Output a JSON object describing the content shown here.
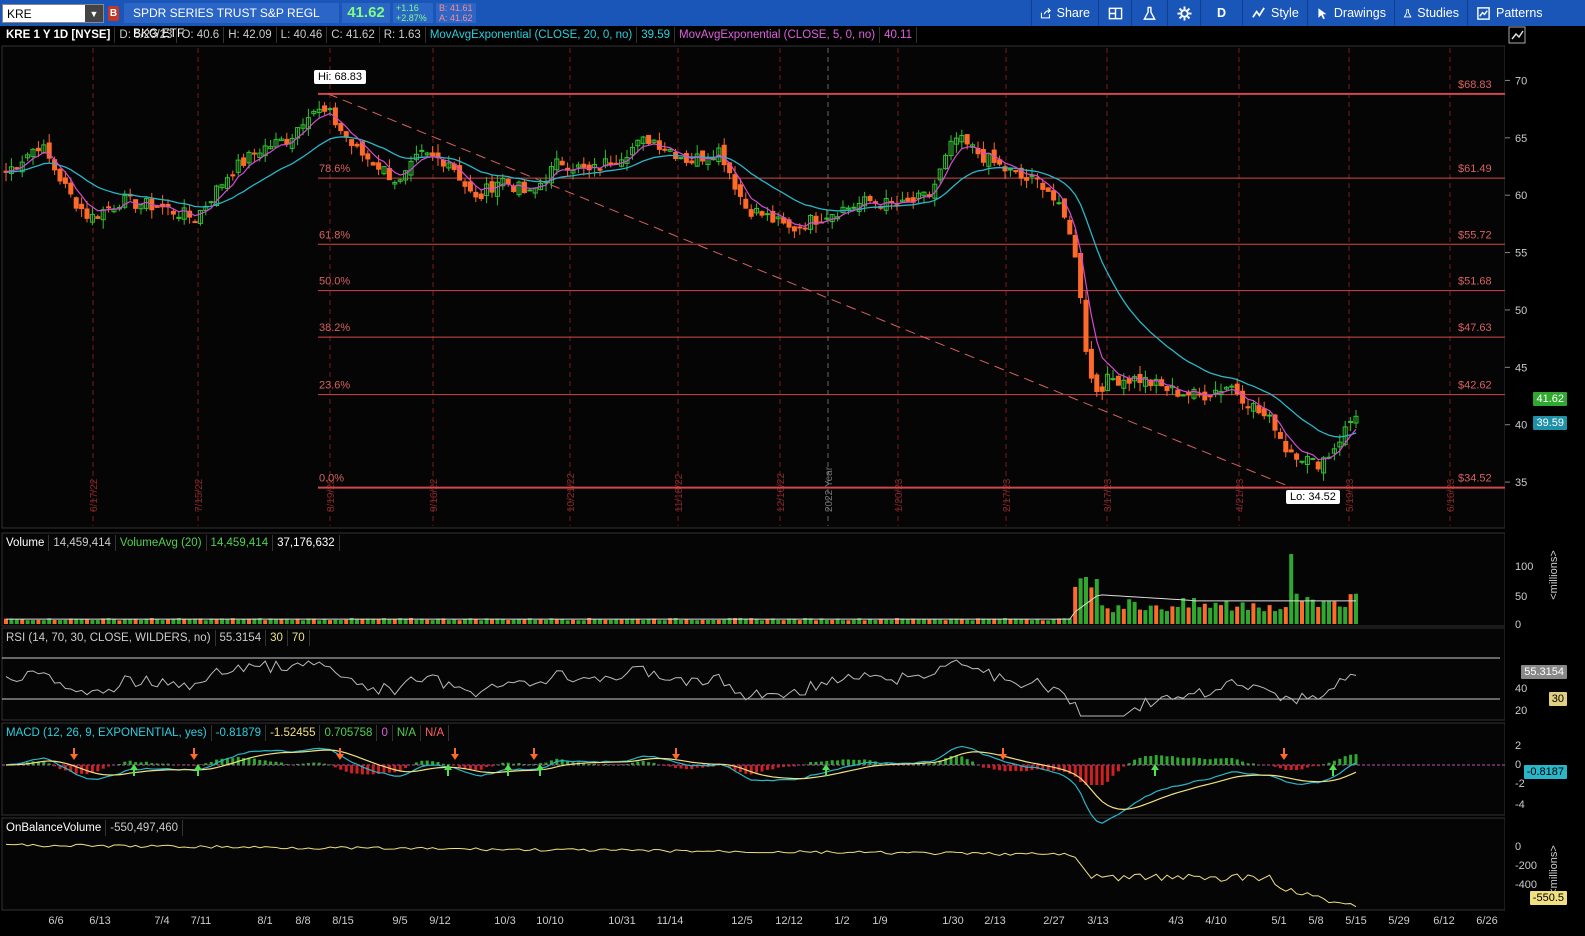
{
  "toolbar": {
    "symbol": "KRE",
    "badge": "B",
    "description": "SPDR SERIES TRUST S&P REGL BKG ETF",
    "last": "41.62",
    "change": "+1.16",
    "change_pct": "+2.87%",
    "bid": "B: 41.61",
    "ask": "A: 41.62",
    "share_label": "Share",
    "aggregation_label": "D",
    "style_label": "Style",
    "drawings_label": "Drawings",
    "studies_label": "Studies",
    "patterns_label": "Patterns"
  },
  "price_legend": {
    "title": "KRE 1 Y 1D [NYSE]",
    "date": "D: 5/23/23",
    "open": "O: 40.6",
    "high": "H: 42.09",
    "low": "L: 40.46",
    "close": "C: 41.62",
    "range": "R: 1.63",
    "ema20_label": "MovAvgExponential (CLOSE, 20, 0, no)",
    "ema20_value": "39.59",
    "ema5_label": "MovAvgExponential (CLOSE, 5, 0, no)",
    "ema5_value": "40.11"
  },
  "volume_legend": {
    "label": "Volume",
    "value": "14,459,414",
    "avg_label": "VolumeAvg (20)",
    "avg_value": "14,459,414",
    "avg2": "37,176,632"
  },
  "rsi_legend": {
    "label": "RSI (14, 70, 30, CLOSE, WILDERS, no)",
    "value": "55.3154",
    "lo": "30",
    "hi": "70"
  },
  "macd_legend": {
    "label": "MACD (12, 26, 9, EXPONENTIAL, yes)",
    "v1": "-0.81879",
    "v2": "-1.52455",
    "v3": "0.705758",
    "v4": "0",
    "v5": "N/A",
    "v6": "N/A"
  },
  "obv_legend": {
    "label": "OnBalanceVolume",
    "value": "-550,497,460"
  },
  "price_tags": {
    "last": "41.62",
    "ema": "39.59",
    "rsi": "55.3154",
    "rsi30": "30",
    "macd": "-0.8187",
    "obv": "-550.5"
  },
  "hi_label": "Hi: 68.83",
  "lo_label": "Lo: 34.52",
  "fib_levels": [
    {
      "pct": "",
      "price": "$68.83",
      "value": 68.83
    },
    {
      "pct": "78.6%",
      "price": "$61.49",
      "value": 61.49
    },
    {
      "pct": "61.8%",
      "price": "$55.72",
      "value": 55.72
    },
    {
      "pct": "50.0%",
      "price": "$51.68",
      "value": 51.68
    },
    {
      "pct": "38.2%",
      "price": "$47.63",
      "value": 47.63
    },
    {
      "pct": "23.6%",
      "price": "$42.62",
      "value": 42.62
    },
    {
      "pct": "0.0%",
      "price": "$34.52",
      "value": 34.52
    }
  ],
  "price_axis_ticks": [
    70,
    65,
    60,
    55,
    50,
    45,
    40,
    35
  ],
  "volume_axis_ticks": [
    "100",
    "50",
    "0"
  ],
  "rsi_axis_ticks": [
    "40",
    "20"
  ],
  "macd_axis_ticks": [
    "2",
    "0",
    "-2",
    "-4"
  ],
  "obv_axis_ticks": [
    "0",
    "-200",
    "-400"
  ],
  "millions_label": "<millions>",
  "vline_labels": [
    "6/17/22",
    "7/15/22",
    "8/19/22",
    "9/16/22",
    "10/21/22",
    "11/18/22",
    "12/16/22",
    "2022 Year",
    "1/20/23",
    "2/17/23",
    "3/17/23",
    "4/21/23",
    "5/19/23",
    "6/16/23"
  ],
  "x_axis_labels": [
    "6/6",
    "6/13",
    "7/4",
    "7/11",
    "8/1",
    "8/8",
    "8/15",
    "9/5",
    "9/12",
    "10/3",
    "10/10",
    "10/31",
    "11/14",
    "12/5",
    "12/12",
    "1/2",
    "1/9",
    "1/30",
    "2/13",
    "2/27",
    "3/13",
    "4/3",
    "4/10",
    "5/1",
    "5/8",
    "5/15",
    "5/29",
    "6/12",
    "6/26"
  ],
  "colors": {
    "toolbar": "#1a56b8",
    "up": "#31c131",
    "down": "#ff6a2a",
    "ema20": "#29b6c8",
    "ema5": "#d44ad4",
    "fib": "#e05050"
  },
  "chart_data": {
    "type": "candlestick",
    "title": "KRE 1 Y 1D [NYSE]",
    "close_series_approx": [
      {
        "x": "6/6/22",
        "close": 62.0
      },
      {
        "x": "6/13/22",
        "close": 58.5
      },
      {
        "x": "7/4/22",
        "close": 59.5
      },
      {
        "x": "7/11/22",
        "close": 58.0
      },
      {
        "x": "8/1/22",
        "close": 63.5
      },
      {
        "x": "8/8/22",
        "close": 67.5
      },
      {
        "x": "8/15/22",
        "close": 65.5
      },
      {
        "x": "9/5/22",
        "close": 61.5
      },
      {
        "x": "9/12/22",
        "close": 63.5
      },
      {
        "x": "10/3/22",
        "close": 60.5
      },
      {
        "x": "10/10/22",
        "close": 60.0
      },
      {
        "x": "10/31/22",
        "close": 63.0
      },
      {
        "x": "11/14/22",
        "close": 63.5
      },
      {
        "x": "12/5/22",
        "close": 59.5
      },
      {
        "x": "12/12/22",
        "close": 57.0
      },
      {
        "x": "1/2/23",
        "close": 58.5
      },
      {
        "x": "1/9/23",
        "close": 59.0
      },
      {
        "x": "1/30/23",
        "close": 64.0
      },
      {
        "x": "2/13/23",
        "close": 62.5
      },
      {
        "x": "2/27/23",
        "close": 58.0
      },
      {
        "x": "3/13/23",
        "close": 43.0
      },
      {
        "x": "4/3/23",
        "close": 42.5
      },
      {
        "x": "4/10/23",
        "close": 43.0
      },
      {
        "x": "5/1/23",
        "close": 38.0
      },
      {
        "x": "5/8/23",
        "close": 36.5
      },
      {
        "x": "5/15/23",
        "close": 39.5
      },
      {
        "x": "5/23/23",
        "close": 41.62
      }
    ],
    "hi": 68.83,
    "lo": 34.52,
    "ylim": [
      31,
      73
    ]
  }
}
